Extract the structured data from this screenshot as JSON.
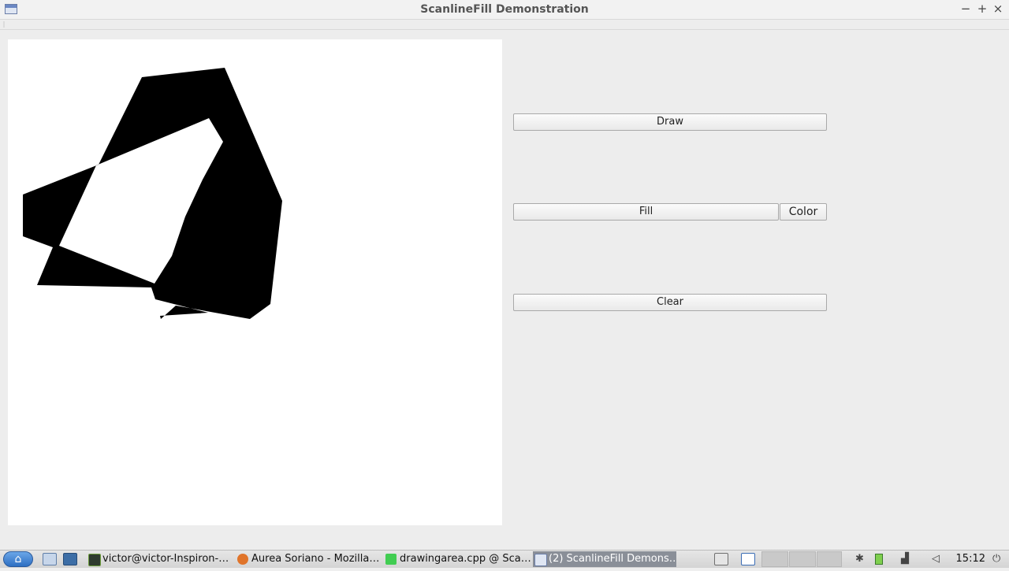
{
  "window": {
    "title": "ScanlineFill Demonstration",
    "minimize_glyph": "−",
    "maximize_glyph": "+",
    "close_glyph": "×"
  },
  "controls": {
    "draw_label": "Draw",
    "fill_label": "Fill",
    "color_label": "Color",
    "clear_label": "Clear"
  },
  "canvas": {
    "fill_color": "#000000",
    "background": "#ffffff"
  },
  "taskbar": {
    "start_icon": "start-menu-icon",
    "tasks": [
      {
        "label": "victor@victor-Inspiron-…",
        "icon": "terminal-icon",
        "active": false
      },
      {
        "label": "Aurea Soriano - Mozilla…",
        "icon": "firefox-icon",
        "active": false
      },
      {
        "label": "drawingarea.cpp @ Sca…",
        "icon": "qtcreator-icon",
        "active": false
      },
      {
        "label": "(2) ScanlineFill Demons…",
        "icon": "app-window-icon",
        "active": true
      }
    ],
    "clock": "15:12"
  }
}
